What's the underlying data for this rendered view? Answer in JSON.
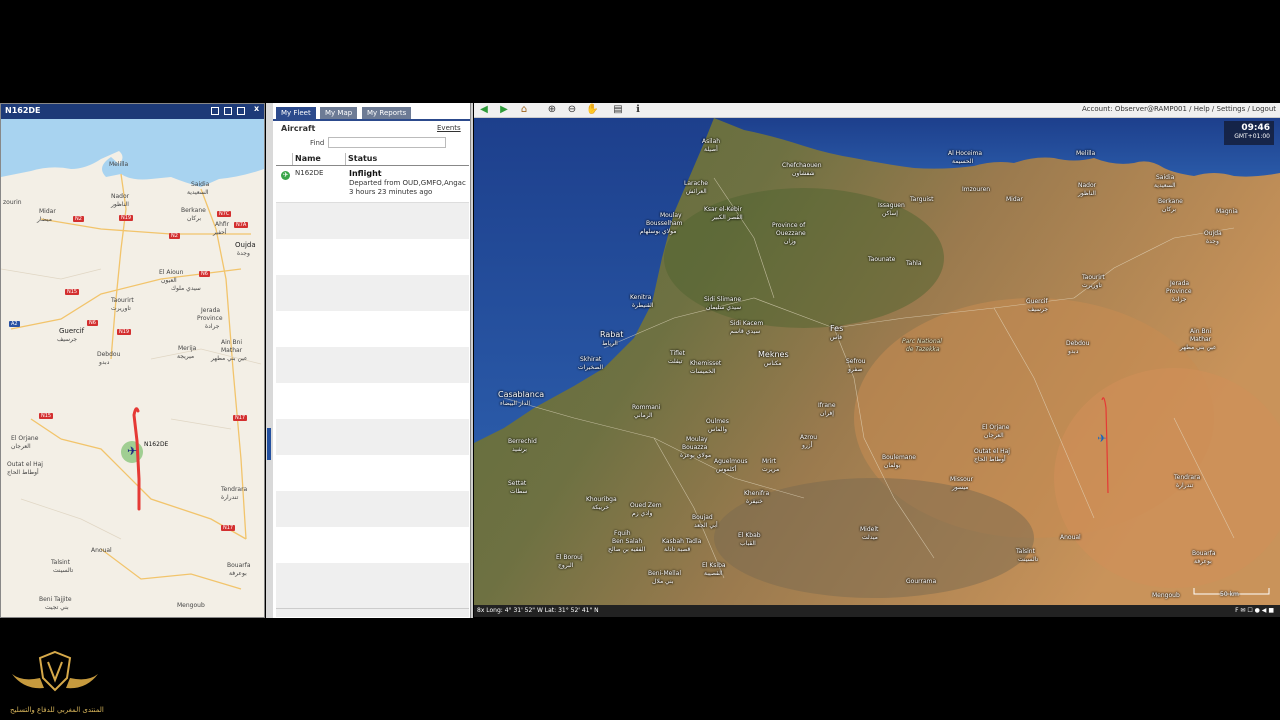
{
  "left_window": {
    "title": "N162DE",
    "close_glyph": "x",
    "map_labels": {
      "melilla": "Melilla",
      "nador": "Nador",
      "nador_ar": "الناظور",
      "saidia": "Saidia",
      "saidia_ar": "السعيدية",
      "berkane": "Berkane",
      "berkane_ar": "بركان",
      "ahfir": "Ahfir",
      "ahfir_ar": "أحفير",
      "oujda": "Oujda",
      "oujda_ar": "وجدة",
      "zourin": "zourin",
      "midar": "Midar",
      "midar_ar": "ميضار",
      "el_aioun": "El Aioun",
      "el_aioun_ar": "العيون",
      "el_aioun_ar2": "سيدي ملوك",
      "taourirt": "Taourirt",
      "taourirt_ar": "تاوريرت",
      "jerada": "Jerada",
      "jerada_ar": "Province",
      "jerada_ar2": "جرادة",
      "guercif": "Guercif",
      "guercif_ar": "جرسيف",
      "ain_bni": "Ain Bni",
      "ain_bni2": "Mathar",
      "ain_bni_ar": "عين بني مطهر",
      "debdou": "Debdou",
      "debdou_ar": "دبدو",
      "merija": "Merija",
      "merija_ar": "ميريجة",
      "el_orjane": "El Orjane",
      "el_orjane_ar": "العرجان",
      "outat": "Outat el Haj",
      "outat_ar": "أوطاط الحاج",
      "tendrara": "Tendrara",
      "tendrara_ar": "تندرارة",
      "anoual": "Anoual",
      "talsint": "Talsint",
      "talsint_ar": "تالسينت",
      "bouarfa": "Bouarfa",
      "bouarfa_ar": "بوعرفة",
      "beni_tajite": "Beni Tajjite",
      "beni_tajite_ar": "بني تجيت",
      "mengoub": "Mengoub",
      "aircraft": "N162DE"
    },
    "roads": [
      "N2",
      "N19",
      "N2",
      "N7C",
      "N7A",
      "N6",
      "N15",
      "N6",
      "A2",
      "N19",
      "N15",
      "N17",
      "N17",
      "N17",
      "N16"
    ]
  },
  "fleet": {
    "tabs": [
      "My Fleet",
      "My Map",
      "My Reports"
    ],
    "section": "Aircraft",
    "events": "Events",
    "find_label": "Find",
    "columns": [
      "Name",
      "Status"
    ],
    "rows": [
      {
        "name": "N162DE",
        "status": "Inflight",
        "detail1": "Departed from OUD,GMFO,Angac",
        "detail2": "3 hours 23 minutes  ago"
      }
    ]
  },
  "right_map": {
    "account": "Account: Observer@RAMP001 / Help / Settings / Logout",
    "clock": "09:46",
    "tz": "GMT+01:00",
    "status_coords": "8x  Long: 4° 31' 52\" W   Lat: 31° 52' 41\" N",
    "status_right": "F ✉ ☐ ● ◀ ■",
    "labels": {
      "asilah": "Asilah",
      "asilah_ar": "أصيلة",
      "chefchaouen": "Chefchaouen",
      "chefchaouen_ar": "شفشاون",
      "alhoceima": "Al Hoceima",
      "alhoceima_ar": "الحسيمة",
      "melilla": "Melilla",
      "nador": "Nador",
      "nador_ar": "الناظور",
      "saidia": "Saidia",
      "saidia_ar": "السعيدية",
      "berkane": "Berkane",
      "berkane_ar": "بركان",
      "magnia": "Magnia",
      "oujda": "Oujda",
      "oujda_ar": "وجدة",
      "larache": "Larache",
      "larache_ar": "العرائش",
      "ksar": "Ksar el-Kebir",
      "ksar_ar": "القصر الكبير",
      "moulay": "Moulay",
      "moulay2": "Bousselham",
      "moulay_ar": "مولاي بوسلهام",
      "ouezzane": "Province of",
      "ouezzane2": "Ouezzane",
      "ouezzane_ar": "وزان",
      "issaguen": "Issaguen",
      "issaguen_ar": "إساكن",
      "targuist": "Targuist",
      "imzouren": "Imzouren",
      "midar": "Midar",
      "kenitra": "Kenitra",
      "kenitra_ar": "القنيطرة",
      "sidi_slimane": "Sidi Slimane",
      "sidi_slimane_ar": "سيدي سليمان",
      "sidi_kacem": "Sidi Kacem",
      "sidi_kacem_ar": "سيدي قاسم",
      "taounate": "Taounate",
      "tahla": "Tahla",
      "taourirt": "Taourirt",
      "taourirt_ar": "تاوريرت",
      "jerada": "Jerada",
      "jerada2": "Province",
      "jerada_ar": "جرادة",
      "guercif": "Guercif",
      "guercif_ar": "جرسيف",
      "rabat": "Rabat",
      "rabat_ar": "الرباط",
      "fes": "Fes",
      "fes_ar": "فاس",
      "park": "Parc National",
      "park2": "de Tazekka",
      "tiflet": "Tiflet",
      "tiflet_ar": "تيفلت",
      "khemisset": "Khemisset",
      "khemisset_ar": "الخميسات",
      "meknes": "Meknes",
      "meknes_ar": "مكناس",
      "sefrou": "Sefrou",
      "sefrou_ar": "صفرو",
      "skhirat": "Skhirat",
      "skhirat_ar": "الصخيرات",
      "debdou": "Debdou",
      "debdou_ar": "دبدو",
      "ain_bni": "Ain Bni",
      "ain_bni2": "Mathar",
      "ain_bni_ar": "عين بني مطهر",
      "casablanca": "Casablanca",
      "casablanca_ar": "الدار البيضاء",
      "rommani": "Rommani",
      "rommani_ar": "الرماني",
      "berrechid": "Berrechid",
      "berrechid_ar": "برشيد",
      "oulmes": "Oulmes",
      "oulmes_ar": "والماس",
      "azrou": "Azrou",
      "azrou_ar": "أزرو",
      "ifrane": "Ifrane",
      "ifrane_ar": "إفران",
      "el_orjane": "El Orjane",
      "el_orjane_ar": "العرجان",
      "outat": "Outat el Haj",
      "outat_ar": "أوطاط الحاج",
      "moulay2b": "Moulay",
      "moulay2b2": "Bouazza",
      "moulay2b_ar": "مولاي بوعزة",
      "aguelmous": "Aguelmous",
      "aguelmous_ar": "أكلموس",
      "mrirt": "Mrirt",
      "mrirt_ar": "مريرت",
      "boulemane": "Boulemane",
      "boulemane_ar": "بولمان",
      "missour": "Missour",
      "missour_ar": "ميسور",
      "tendrara": "Tendrara",
      "tendrara_ar": "تندرارة",
      "settat": "Settat",
      "settat_ar": "سطات",
      "khouribga": "Khouribga",
      "khouribga_ar": "خريبكة",
      "khenifra": "Khenifra",
      "khenifra_ar": "خنيفرة",
      "gourrama": "Gourrama",
      "gourrama_ar": "كرامة",
      "oued_zem": "Oued Zem",
      "oued_zem_ar": "وادي زم",
      "boujad": "Boujad",
      "boujad_ar": "أبي الجعد",
      "kasba": "Kasbah Tadla",
      "kasba_ar": "قصبة تادلة",
      "elkbab": "El Kbab",
      "elkbab_ar": "القباب",
      "midelt": "Midelt",
      "midelt_ar": "ميدلت",
      "elbrouj": "El Borouj",
      "elbrouj_ar": "البروج",
      "ben_salah": "Fquih",
      "ben_salah2": "Ben Salah",
      "ben_salah_ar": "الفقيه بن صالح",
      "beni_mellal": "Beni-Mellal",
      "beni_mellal_ar": "بني ملال",
      "el_ksiba": "El Ksiba",
      "el_ksiba_ar": "القصيبة",
      "anoual": "Anoual",
      "talsint": "Talsint",
      "talsint_ar": "تالسينت",
      "bouarfa": "Bouarfa",
      "bouarfa_ar": "بوعرفة",
      "mengoub": "Mengoub",
      "gourama2": "Gourrama",
      "scale": "50 km"
    }
  },
  "logo": {
    "caption": "المنتدى المغربي للدفاع والتسليح"
  }
}
